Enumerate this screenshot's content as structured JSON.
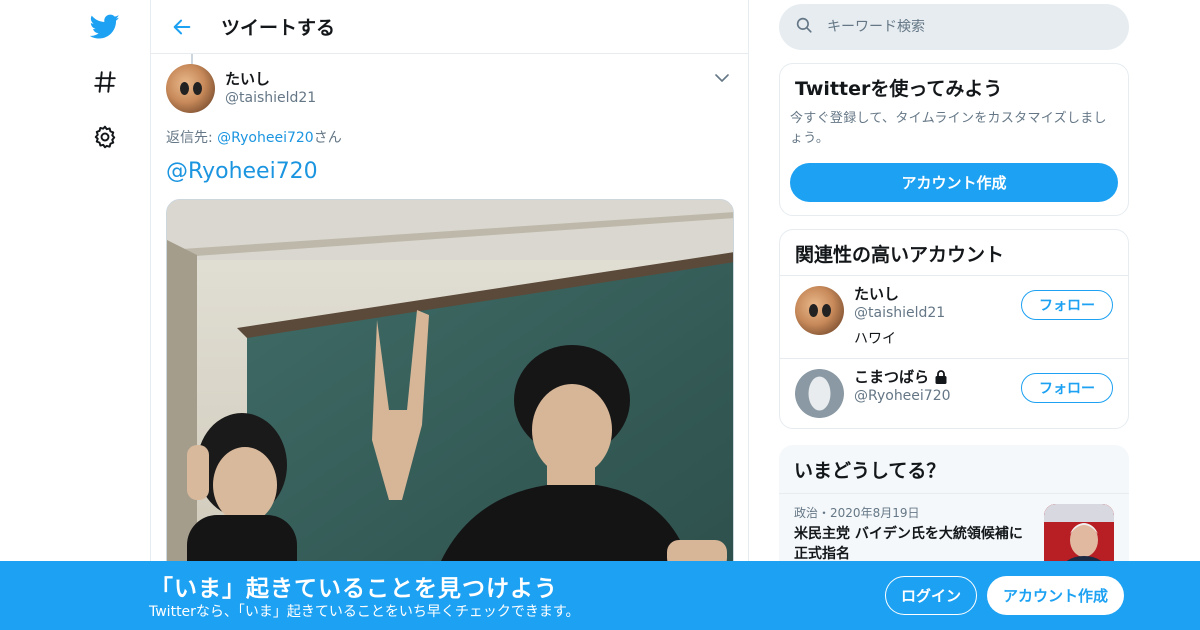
{
  "colors": {
    "accent": "#1da1f2",
    "link": "#1b95e0",
    "muted": "#657786",
    "border": "#e6ecf0"
  },
  "rail": {
    "icons": [
      "twitter-bird-icon",
      "hashtag-icon",
      "settings-gear-icon"
    ]
  },
  "header": {
    "title": "ツイートする"
  },
  "tweet": {
    "author_name": "たいし",
    "author_handle": "@taishield21",
    "reply_prefix": "返信先: ",
    "reply_handle": "@Ryoheei720",
    "reply_suffix": "さん",
    "text": "@Ryoheei720"
  },
  "search": {
    "placeholder": "キーワード検索"
  },
  "signup_card": {
    "title": "Twitterを使ってみよう",
    "description": "今すぐ登録して、タイムラインをカスタマイズしましょう。",
    "button": "アカウント作成"
  },
  "related": {
    "title": "関連性の高いアカウント",
    "accounts": [
      {
        "name": "たいし",
        "handle": "@taishield21",
        "bio": "ハワイ",
        "follow": "フォロー"
      },
      {
        "name": "こまつばら",
        "handle": "@Ryoheei720",
        "bio": "",
        "follow": "フォロー"
      }
    ]
  },
  "trends": {
    "title": "いまどうしてる？",
    "items": [
      {
        "category": "政治",
        "dot": "・",
        "date": "2020年8月19日",
        "headline": "米民主党 バイデン氏を大統領候補に正式指名"
      }
    ]
  },
  "banner": {
    "title": "「いま」起きていることを見つけよう",
    "subtitle": "Twitterなら、「いま」起きていることをいち早くチェックできます。",
    "login": "ログイン",
    "signup": "アカウント作成"
  }
}
